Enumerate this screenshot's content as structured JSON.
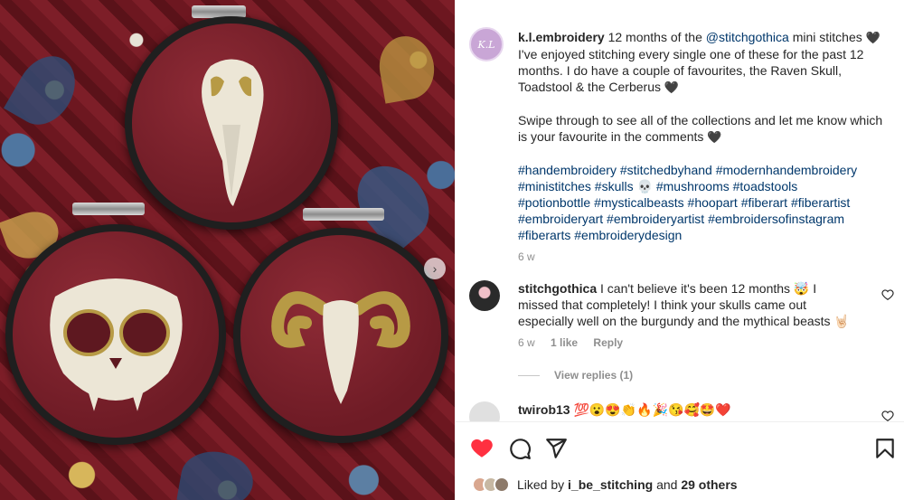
{
  "post": {
    "username": "k.l.embroidery",
    "avatar_text": "K.L",
    "caption_pre": " 12 months of the ",
    "mention": "@stitchgothica",
    "caption_line1_post": " mini stitches",
    "caption_body": "I've enjoyed stitching every single one of these for the past 12 months. I do have a couple of favourites, the Raven Skull, Toadstool & the Cerberus",
    "caption_para2": "Swipe through to see all of the collections and let me know which is your favourite in the comments",
    "hashtags_line1": "#handembroidery #stitchedbyhand #modernhandembroidery",
    "hashtags_line2a": "#ministitches #skulls",
    "hashtags_line2b": "#mushrooms #toadstools",
    "hashtags_line3": "#potionbottle #mysticalbeasts #hoopart #fiberart #fiberartist",
    "hashtags_line4": "#embroideryart #embroideryartist #embroidersofinstagram",
    "hashtags_line5": "#fiberarts #embroiderydesign",
    "time": "6 w",
    "black_heart": "🖤",
    "skull_emoji": "💀"
  },
  "comments": [
    {
      "username": "stitchgothica",
      "text": "I can't believe it's been 12 months 🤯 I missed that completely! I think your skulls came out especially well on the burgundy and the mythical beasts 🤘🏻",
      "time": "6 w",
      "likes": "1 like",
      "reply": "Reply"
    },
    {
      "username": "twirob13",
      "text": "💯😮😍👏🔥🎉😘🥰🤩❤️"
    }
  ],
  "view_replies": "View replies (1)",
  "likes_summary": {
    "prefix": "Liked by ",
    "user": "i_be_stitching",
    "middle": " and ",
    "others": "29 others"
  },
  "colors": {
    "link": "#00376b",
    "heart_red": "#ff3040",
    "meta_gray": "#8e8e8e"
  },
  "icons": [
    "heart-filled-icon",
    "comment-icon",
    "share-icon",
    "bookmark-icon",
    "like-outline-icon",
    "next-arrow-icon"
  ]
}
